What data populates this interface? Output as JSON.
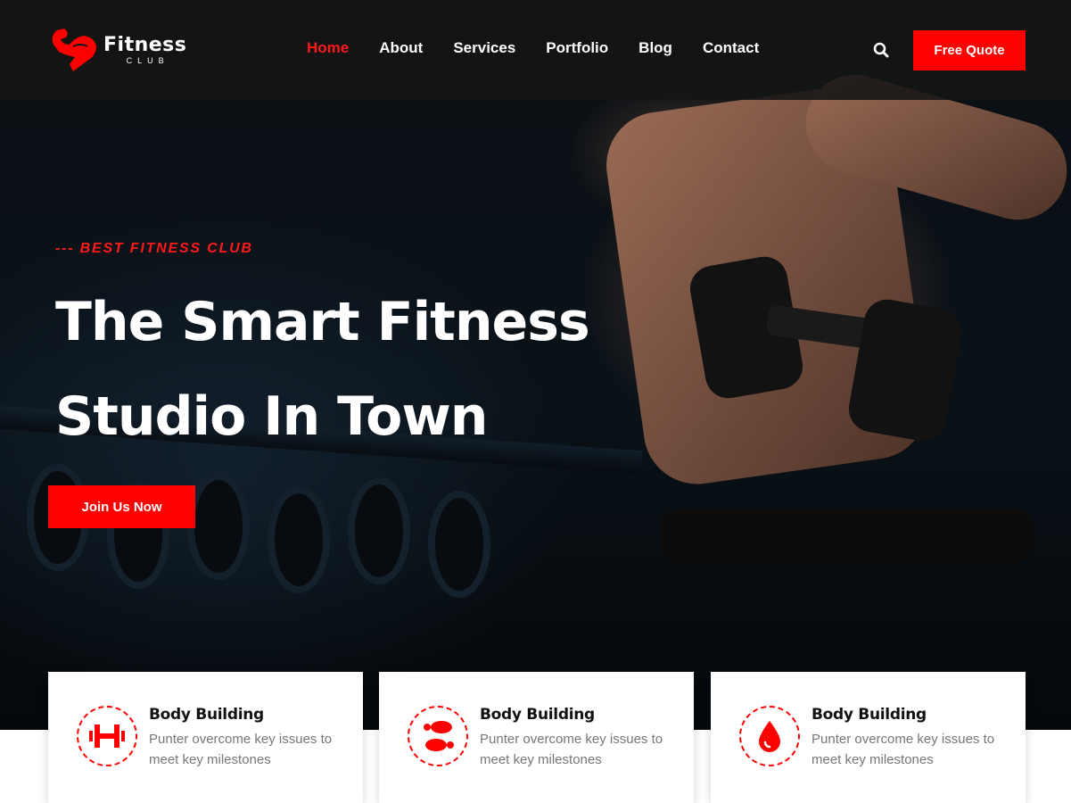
{
  "brand": {
    "title": "Fitness",
    "subtitle": "CLUB"
  },
  "nav": {
    "items": [
      {
        "label": "Home",
        "active": true
      },
      {
        "label": "About",
        "active": false
      },
      {
        "label": "Services",
        "active": false
      },
      {
        "label": "Portfolio",
        "active": false
      },
      {
        "label": "Blog",
        "active": false
      },
      {
        "label": "Contact",
        "active": false
      }
    ],
    "search_icon": "search-icon",
    "cta_label": "Free Quote"
  },
  "hero": {
    "tagline": "--- BEST FITNESS CLUB",
    "headline_line1": "The Smart Fitness",
    "headline_line2": "Studio In Town",
    "cta_label": "Join Us Now"
  },
  "features": [
    {
      "icon": "dumbbell-icon",
      "title": "Body Building",
      "description": "Punter overcome key issues to meet key milestones"
    },
    {
      "icon": "footprints-icon",
      "title": "Body Building",
      "description": "Punter overcome key issues to meet key milestones"
    },
    {
      "icon": "drop-icon",
      "title": "Body Building",
      "description": "Punter overcome key issues to meet key milestones"
    }
  ],
  "colors": {
    "accent": "#ff0000",
    "header_bg": "#141414",
    "card_text": "#777777"
  }
}
